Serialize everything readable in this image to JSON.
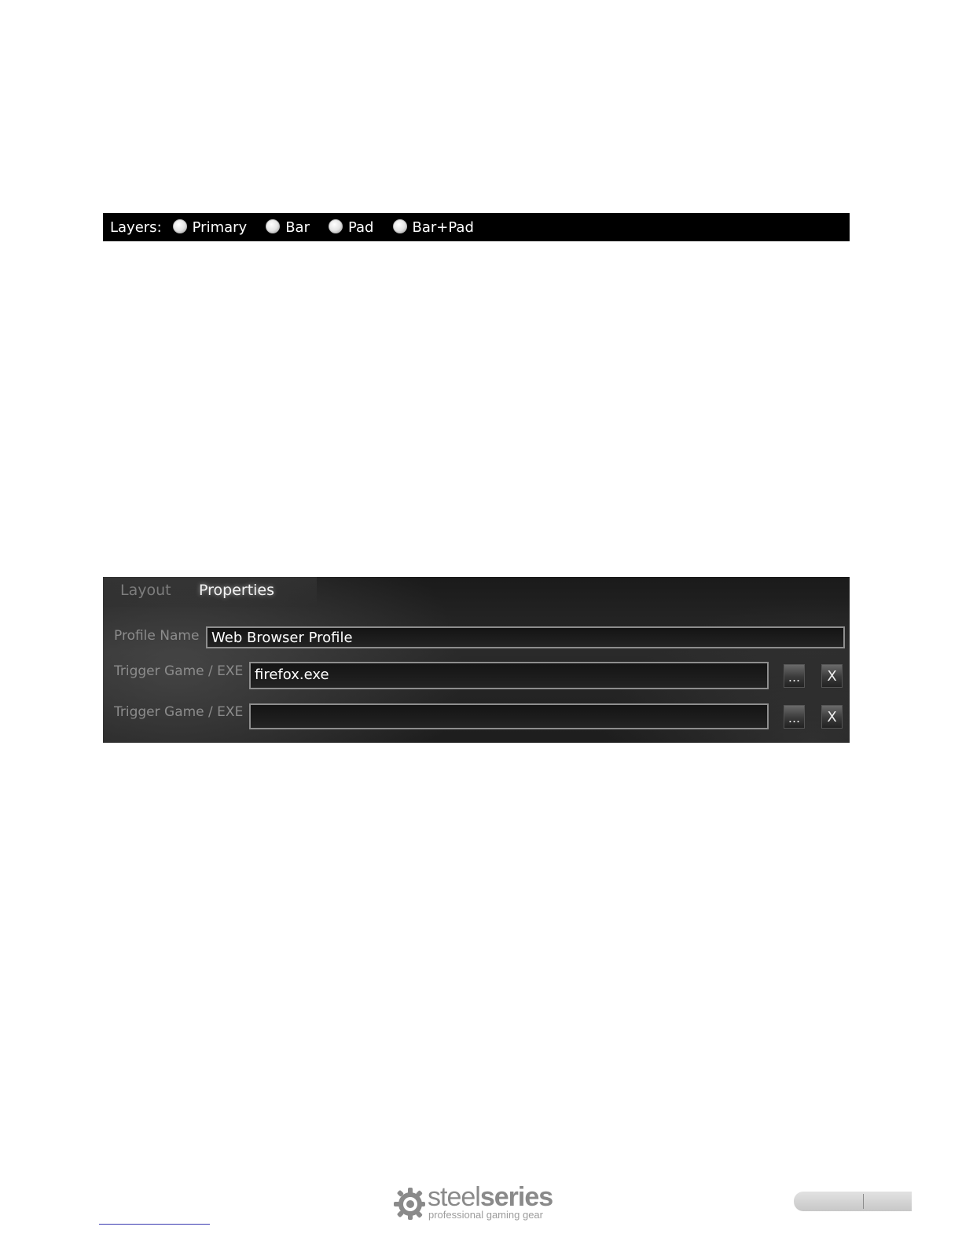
{
  "layers": {
    "label": "Layers:",
    "options": [
      "Primary",
      "Bar",
      "Pad",
      "Bar+Pad"
    ]
  },
  "properties_panel": {
    "tabs": {
      "layout": "Layout",
      "properties": "Properties"
    },
    "profile_name_label": "Profile Name",
    "profile_name_value": "Web Browser Profile",
    "trigger_label": "Trigger Game / EXE",
    "triggers": [
      {
        "value": "firefox.exe",
        "browse": "...",
        "clear": "X"
      },
      {
        "value": "",
        "browse": "...",
        "clear": "X"
      }
    ]
  },
  "footer": {
    "brand_light": "steel",
    "brand_bold": "series",
    "tagline": "professional gaming gear"
  }
}
